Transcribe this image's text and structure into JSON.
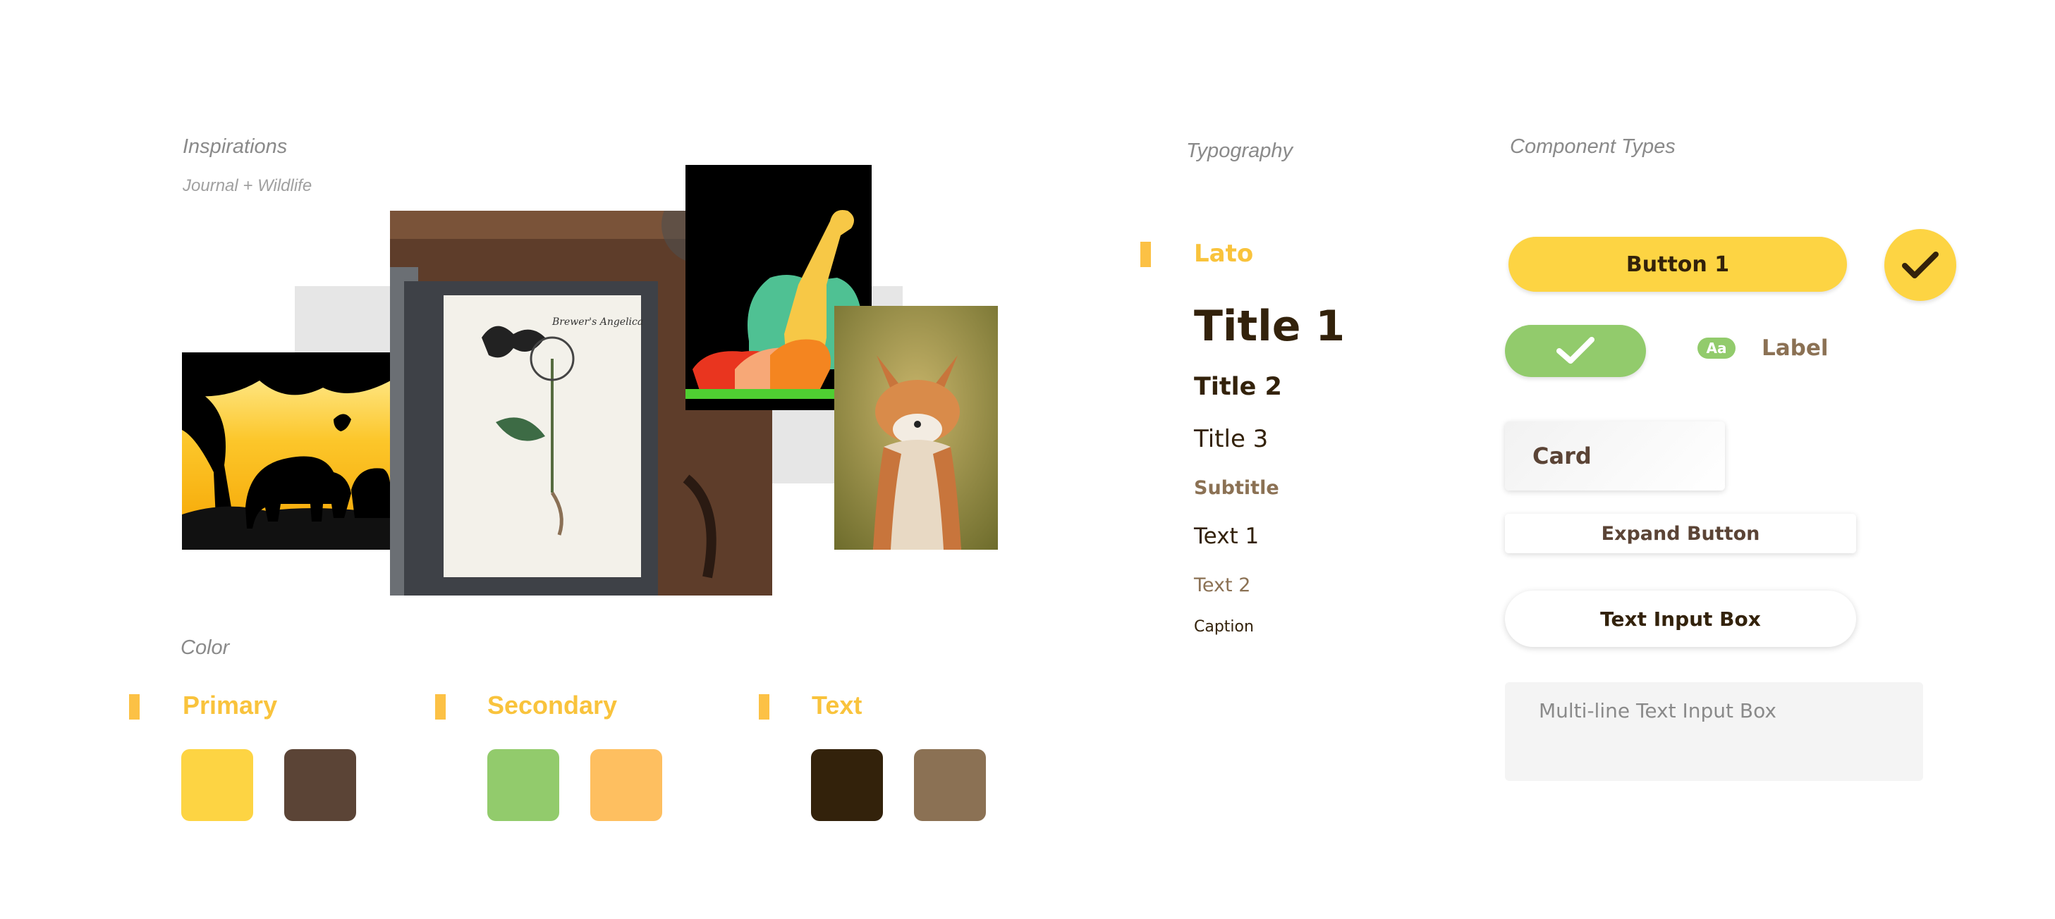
{
  "inspirations": {
    "heading": "Inspirations",
    "subheading": "Journal + Wildlife",
    "journal_title": "Brewer's Angelica"
  },
  "color": {
    "heading": "Color",
    "groups": [
      {
        "label": "Primary",
        "swatches": [
          "#fdd443",
          "#5b4436"
        ]
      },
      {
        "label": "Secondary",
        "swatches": [
          "#92cb6c",
          "#febf60"
        ]
      },
      {
        "label": "Text",
        "swatches": [
          "#33220b",
          "#8b7154"
        ]
      }
    ],
    "accent": "#fcc145"
  },
  "typography": {
    "heading": "Typography",
    "font_name": "Lato",
    "styles": {
      "title1": "Title 1",
      "title2": "Title 2",
      "title3": "Title 3",
      "subtitle": "Subtitle",
      "text1": "Text 1",
      "text2": "Text 2",
      "caption": "Caption"
    }
  },
  "components": {
    "heading": "Component Types",
    "button1": "Button 1",
    "badge": "Aa",
    "label": "Label",
    "card": "Card",
    "expand_button": "Expand Button",
    "text_input": "Text Input Box",
    "multiline_placeholder": "Multi-line Text Input Box"
  }
}
